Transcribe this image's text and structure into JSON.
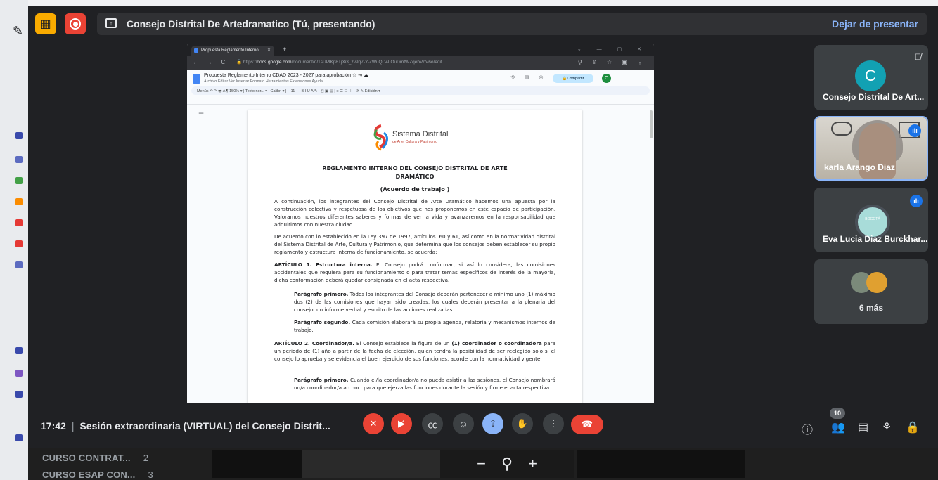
{
  "meet": {
    "presenting_title": "Consejo Distrital De Artedramatico (Tú, presentando)",
    "stop_presenting": "Dejar de presentar",
    "clock": "17:42",
    "meeting_title": "Sesión extraordinaria (VIRTUAL) del Consejo Distrit...",
    "people_count": "10"
  },
  "participants": [
    {
      "name": "Consejo Distrital De Art...",
      "initial": "C"
    },
    {
      "name": "karla Arango Diaz"
    },
    {
      "name": "Eva Lucia Diaz Burckhar...",
      "avatar_text": "BOGOTÁ"
    },
    {
      "name": "6 más"
    }
  ],
  "browser": {
    "tab_title": "Propuesta Reglamento Interno",
    "url_prefix": "https://",
    "url_domain": "docs.google.com",
    "url_path": "/document/d/1sUPlKp8TjXi3_zv9q7-Y-ZWuQD4LOuDmfWZqebVnV6o/edit"
  },
  "docs": {
    "title": "Propuesta Reglamento Interno CDAD 2023 - 2027 para aprobación",
    "menu": "Archivo   Editar   Ver   Insertar   Formato   Herramientas   Extensiones   Ayuda",
    "share": "Compartir",
    "avatar": "C",
    "toolbar": "Menús    ↶  ↷  🖶  A  ¶   150%  ▾  |  Texto nor...  ▾  |  Calibri  ▾  |  −  11  +  |  B  I  U  A  ✎  |  ⎘  ▣  ▤  |  ≡  ☰  ☷  ⋮  |  Ⅸ      ✎ Edición  ▾",
    "logo_title": "Sistema Distrital",
    "logo_sub": "de Arte, Cultura y Patrimonio",
    "heading1": "REGLAMENTO INTERNO DEL CONSEJO DISTRITAL DE ARTE",
    "heading2": "DRAMÁTICO",
    "heading3": "(Acuerdo de trabajo )",
    "p1": "A continuación, los integrantes del Consejo Distrital de Arte Dramático hacemos una apuesta por la construcción colectiva y respetuosa de los objetivos que nos proponemos en este espacio de participación. Valoramos nuestros diferentes saberes y formas de ver la vida y avanzaremos en la responsabilidad que adquirimos con nuestra ciudad.",
    "p2": "De acuerdo con lo establecido en la Ley 397 de 1997, artículos. 60 y 61, así como en la normatividad distrital del Sistema Distrital de Arte, Cultura y Patrimonio, que determina que los consejos deben establecer su propio reglamento y estructura interna de funcionamiento, se acuerda:",
    "a1_label": "ARTÍCULO 1. Estructura interna.",
    "a1_text": " El Consejo podrá conformar, si así lo considera, las comisiones accidentales que requiera para su funcionamiento o para tratar temas específicos de interés de la mayoría, dicha conformación deberá quedar consignada en el acta respectiva.",
    "pp1_label": "Parágrafo primero.",
    "pp1_text": " Todos los integrantes del Consejo deberán pertenecer a mínimo uno (1) máximo dos (2) de las comisiones que hayan sido creadas, los cuales deberán presentar a la plenaria del consejo, un informe verbal y escrito de las acciones realizadas.",
    "pp2_label": "Parágrafo segundo.",
    "pp2_text": " Cada comisión elaborará su propia agenda, relatoría y mecanismos internos de trabajo.",
    "a2_label": "ARTÍCULO 2. Coordinador/a.",
    "a2_text_a": " El Consejo establece la figura de un ",
    "a2_bold": "(1) coordinador o coordinadora",
    "a2_text_b": " para un periodo de (1) año a partir de la fecha de elección, quien tendrá la posibilidad de ser reelegido sólo si el consejo lo aprueba y se evidencia el buen ejercicio de sus funciones, acorde con la normatividad vigente.",
    "pp3_label": "Parágrafo primero.",
    "pp3_text": " Cuando el/la coordinador/a no pueda asistir a las sesiones, el Consejo nombrará un/a coordinador/a ad hoc, para que ejerza las funciones durante la sesión y firme el acta respectiva."
  },
  "background": {
    "row1": "CURSO CONTRAT...",
    "row1_n": "2",
    "row2": "CURSO ESAP CON...",
    "row2_n": "3"
  },
  "icons": {
    "layout": "layout-icon",
    "record": "record-icon",
    "present": "present-icon",
    "mic_off": "mic-off-icon",
    "cam_off": "camera-off-icon",
    "captions": "captions-icon",
    "emoji": "emoji-icon",
    "present_now": "present-now-icon",
    "hand": "raise-hand-icon",
    "more": "more-options-icon",
    "hangup": "hangup-icon",
    "info": "info-icon",
    "people": "people-icon",
    "chat": "chat-icon",
    "activities": "activities-icon",
    "host": "host-controls-icon",
    "zoom_out": "zoom-out-icon",
    "zoom_in": "zoom-in-icon"
  },
  "colors": {
    "meet_bg": "#202124",
    "tile_bg": "#3c4043",
    "accent_blue": "#8ab4f8",
    "danger_red": "#ea4335",
    "record_yellow": "#f9ab00"
  }
}
